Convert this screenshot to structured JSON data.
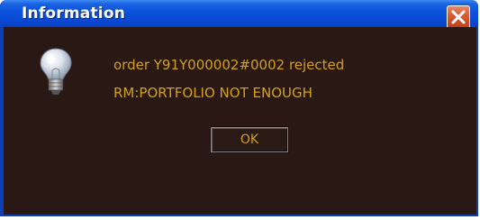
{
  "window": {
    "title": "Information"
  },
  "message": {
    "line1": "order Y91Y000002#0002 rejected",
    "line2": "RM:PORTFOLIO NOT ENOUGH"
  },
  "buttons": {
    "ok_label": "OK"
  },
  "icons": {
    "info": "lightbulb-icon",
    "close": "close-icon"
  },
  "colors": {
    "titlebar": "#0a4cd6",
    "close_button": "#d65a32",
    "client_background": "#2a1814",
    "text": "#d4a017"
  }
}
